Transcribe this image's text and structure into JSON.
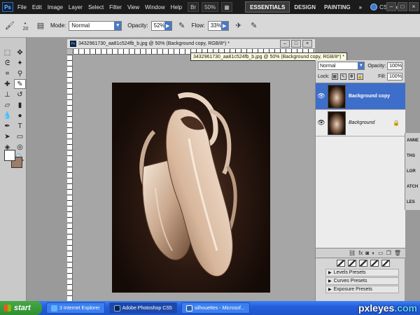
{
  "menubar": {
    "logo": "Ps",
    "items": [
      "File",
      "Edit",
      "Image",
      "Layer",
      "Select",
      "Filter",
      "View",
      "Window",
      "Help"
    ],
    "zoom": "50%",
    "workspaces": [
      "ESSENTIALS",
      "DESIGN",
      "PAINTING"
    ],
    "more": "»",
    "cslive": "CS Live",
    "window_buttons": [
      "–",
      "□",
      "×"
    ]
  },
  "options": {
    "brush_size": "20",
    "mode_label": "Mode:",
    "mode_value": "Normal",
    "opacity_label": "Opacity:",
    "opacity_value": "52%",
    "flow_label": "Flow:",
    "flow_value": "33%"
  },
  "document": {
    "tab_title": "3432961730_aa81c524fb_b.jpg @ 50% (Background copy, RGB/8*) *",
    "tooltip": "3432961730_aa81c524fb_b.jpg @ 50% (Background copy, RGB/8*) *",
    "window_buttons": [
      "–",
      "□",
      "×"
    ]
  },
  "layers_panel": {
    "blend_mode": "Normal",
    "opacity_label": "Opacity:",
    "opacity_value": "100%",
    "lock_label": "Lock:",
    "fill_label": "Fill:",
    "fill_value": "100%",
    "layers": [
      {
        "name": "Background copy",
        "selected": true
      },
      {
        "name": "Background",
        "selected": false
      }
    ]
  },
  "dock": {
    "labels": [
      "ANNE",
      "THS",
      "LOR",
      "ATCH",
      "LES"
    ]
  },
  "adjustments": {
    "presets": [
      "Levels Presets",
      "Curves Presets",
      "Exposure Presets"
    ]
  },
  "taskbar": {
    "start": "start",
    "tasks": [
      "3 Internet Explorer",
      "Adobe Photoshop CS5",
      "silhouettes - Microsof..."
    ]
  },
  "watermark": {
    "text_a": "pxleyes",
    "text_b": ".com"
  }
}
